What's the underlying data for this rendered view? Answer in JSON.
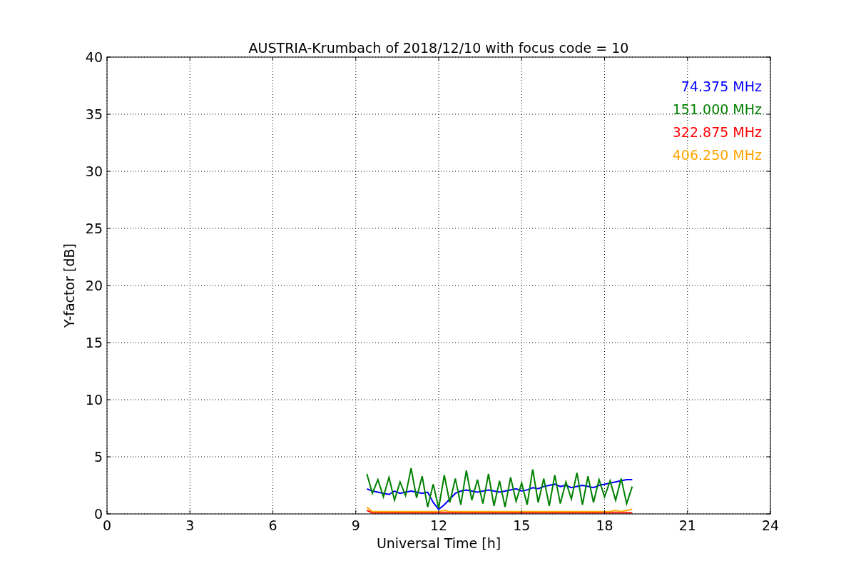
{
  "chart_data": {
    "type": "line",
    "title": "AUSTRIA-Krumbach of 2018/12/10 with focus code = 10",
    "xlabel": "Universal Time [h]",
    "ylabel": "Y-factor [dB]",
    "grid": true,
    "xlim": [
      0,
      24
    ],
    "ylim": [
      0,
      40
    ],
    "xticks": [
      0,
      3,
      6,
      9,
      12,
      15,
      18,
      21,
      24
    ],
    "yticks": [
      0,
      5,
      10,
      15,
      20,
      25,
      30,
      35,
      40
    ],
    "x": [
      9.4,
      9.6,
      9.8,
      10.0,
      10.2,
      10.4,
      10.6,
      10.8,
      11.0,
      11.2,
      11.4,
      11.6,
      11.8,
      12.0,
      12.2,
      12.4,
      12.6,
      12.8,
      13.0,
      13.2,
      13.4,
      13.6,
      13.8,
      14.0,
      14.2,
      14.4,
      14.6,
      14.8,
      15.0,
      15.2,
      15.4,
      15.6,
      15.8,
      16.0,
      16.2,
      16.4,
      16.6,
      16.8,
      17.0,
      17.2,
      17.4,
      17.6,
      17.8,
      18.0,
      18.2,
      18.4,
      18.6,
      18.8,
      19.0
    ],
    "series": [
      {
        "name": "74.375 MHz",
        "color": "#0000ff",
        "values": [
          2.2,
          2.0,
          1.9,
          1.8,
          1.7,
          2.0,
          1.8,
          1.9,
          2.0,
          1.9,
          1.8,
          1.9,
          1.0,
          0.4,
          0.8,
          1.3,
          1.8,
          2.0,
          2.1,
          2.0,
          1.9,
          2.0,
          2.1,
          2.0,
          1.9,
          2.0,
          2.1,
          2.2,
          2.0,
          2.1,
          2.3,
          2.2,
          2.4,
          2.5,
          2.6,
          2.4,
          2.5,
          2.3,
          2.4,
          2.5,
          2.4,
          2.3,
          2.5,
          2.6,
          2.7,
          2.8,
          2.9,
          3.0,
          3.0
        ]
      },
      {
        "name": "151.000 MHz",
        "color": "#008000",
        "values": [
          3.5,
          1.8,
          3.0,
          1.5,
          3.2,
          1.2,
          2.8,
          1.6,
          4.0,
          1.4,
          3.3,
          0.6,
          2.6,
          0.5,
          3.4,
          1.0,
          3.1,
          0.8,
          3.8,
          1.2,
          3.0,
          0.9,
          3.5,
          0.7,
          2.9,
          0.6,
          3.2,
          1.1,
          2.7,
          0.8,
          3.9,
          1.0,
          3.1,
          0.7,
          3.4,
          0.9,
          2.8,
          1.3,
          3.6,
          0.8,
          3.3,
          1.0,
          3.0,
          1.5,
          2.9,
          1.2,
          3.1,
          0.9,
          2.4
        ]
      },
      {
        "name": "322.875 MHz",
        "color": "#ff0000",
        "values": [
          0.3,
          0.1,
          0.1,
          0.1,
          0.1,
          0.1,
          0.1,
          0.1,
          0.1,
          0.1,
          0.1,
          0.1,
          0.1,
          0.1,
          0.1,
          0.1,
          0.1,
          0.1,
          0.1,
          0.1,
          0.1,
          0.1,
          0.1,
          0.1,
          0.1,
          0.1,
          0.1,
          0.1,
          0.1,
          0.1,
          0.1,
          0.1,
          0.1,
          0.1,
          0.1,
          0.1,
          0.1,
          0.1,
          0.1,
          0.1,
          0.1,
          0.1,
          0.1,
          0.1,
          0.1,
          0.1,
          0.1,
          0.1,
          0.1
        ]
      },
      {
        "name": "406.250 MHz",
        "color": "#ffa500",
        "values": [
          0.6,
          0.2,
          0.2,
          0.2,
          0.2,
          0.2,
          0.2,
          0.2,
          0.2,
          0.2,
          0.2,
          0.2,
          0.2,
          0.2,
          0.3,
          0.2,
          0.2,
          0.2,
          0.2,
          0.2,
          0.2,
          0.2,
          0.2,
          0.2,
          0.2,
          0.2,
          0.2,
          0.2,
          0.2,
          0.2,
          0.2,
          0.2,
          0.2,
          0.2,
          0.2,
          0.2,
          0.2,
          0.2,
          0.2,
          0.2,
          0.2,
          0.2,
          0.2,
          0.2,
          0.2,
          0.3,
          0.2,
          0.3,
          0.4
        ]
      }
    ]
  }
}
